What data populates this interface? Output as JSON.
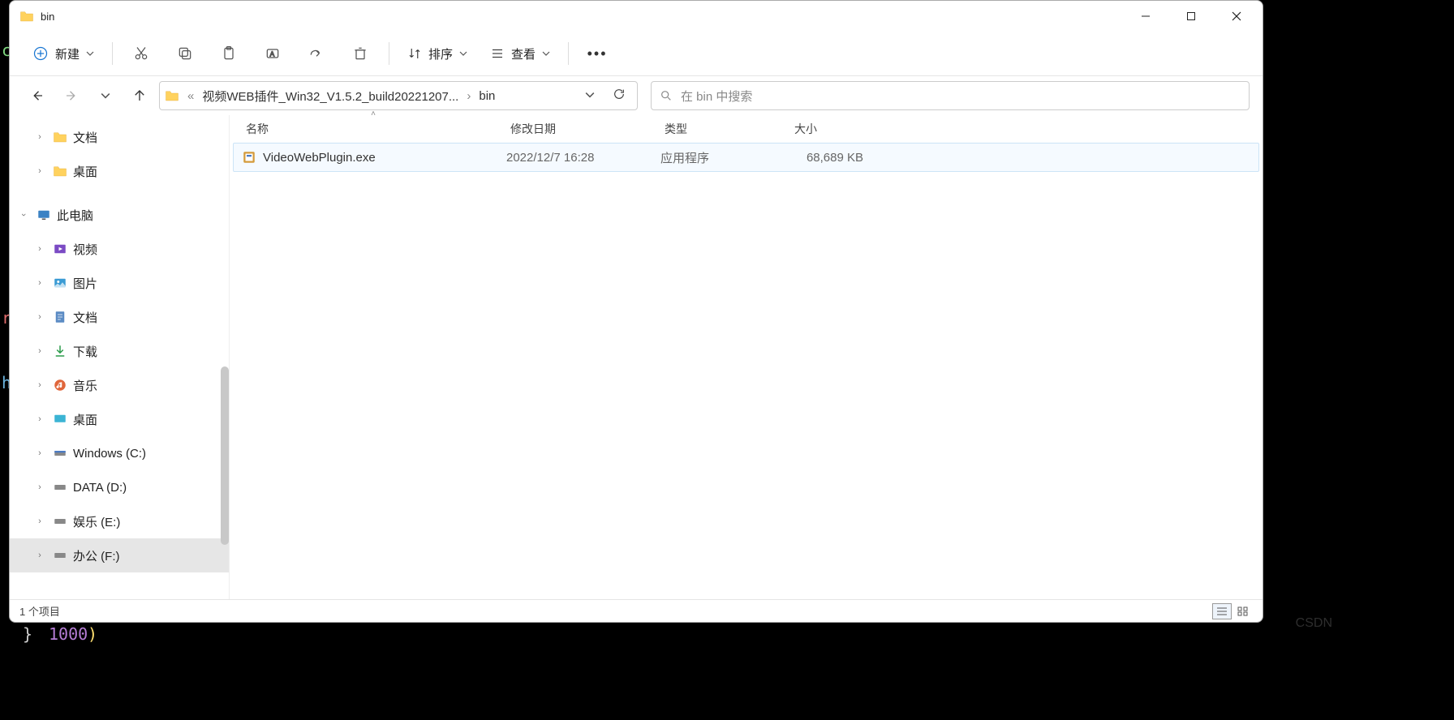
{
  "window": {
    "title": "bin"
  },
  "toolbar": {
    "new_label": "新建",
    "sort_label": "排序",
    "view_label": "查看"
  },
  "addressbar": {
    "prefix": "«",
    "crumb1": "视频WEB插件_Win32_V1.5.2_build20221207...",
    "crumb2": "bin"
  },
  "search": {
    "placeholder": "在 bin 中搜索"
  },
  "sidebar": {
    "items": [
      {
        "label": "文档",
        "icon": "folder"
      },
      {
        "label": "桌面",
        "icon": "folder"
      },
      {
        "label": "此电脑",
        "icon": "pc",
        "expanded": true
      },
      {
        "label": "视频",
        "icon": "video"
      },
      {
        "label": "图片",
        "icon": "pictures"
      },
      {
        "label": "文档",
        "icon": "documents"
      },
      {
        "label": "下载",
        "icon": "downloads"
      },
      {
        "label": "音乐",
        "icon": "music"
      },
      {
        "label": "桌面",
        "icon": "desktop"
      },
      {
        "label": "Windows (C:)",
        "icon": "drive"
      },
      {
        "label": "DATA (D:)",
        "icon": "drive"
      },
      {
        "label": "娱乐 (E:)",
        "icon": "drive"
      },
      {
        "label": "办公 (F:)",
        "icon": "drive",
        "selected": true
      }
    ]
  },
  "columns": {
    "name": "名称",
    "date": "修改日期",
    "type": "类型",
    "size": "大小"
  },
  "files": [
    {
      "name": "VideoWebPlugin.exe",
      "date": "2022/12/7 16:28",
      "type": "应用程序",
      "size": "68,689 KB"
    }
  ],
  "statusbar": {
    "count": "1 个项目"
  },
  "background": {
    "line1": "1000"
  }
}
